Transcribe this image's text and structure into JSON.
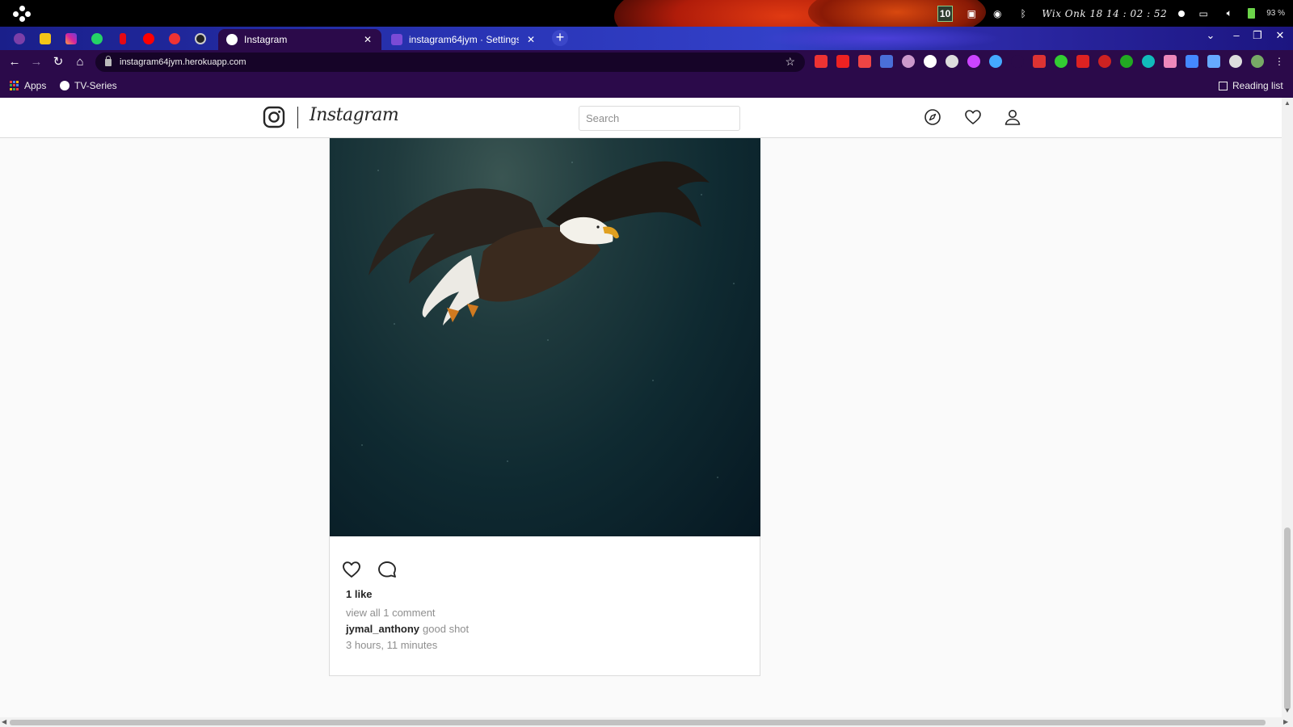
{
  "os_panel": {
    "clock": "Wix Onk 18  14 : 02 : 52",
    "battery": "93 %",
    "badge": "10"
  },
  "browser": {
    "tabs": [
      {
        "title": "Instagram",
        "active": true
      },
      {
        "title": "instagram64jym · Settings |",
        "active": false
      }
    ],
    "new_tab": "+",
    "url": "instagram64jym.herokuapp.com",
    "bookmarks": {
      "apps": "Apps",
      "tv_series": "TV-Series",
      "reading_list": "Reading list"
    }
  },
  "ig_nav": {
    "wordmark": "Instagram",
    "search_placeholder": "Search"
  },
  "post": {
    "likes": "1 like",
    "view_comments": "view all 1 comment",
    "comment_user": "jymal_anthony",
    "comment_text": "good shot",
    "timestamp": "3 hours, 11 minutes"
  },
  "colors": {
    "tab_strip": "#2a36b8",
    "toolbar": "#2b0a4a",
    "page_bg": "#fafafa"
  }
}
